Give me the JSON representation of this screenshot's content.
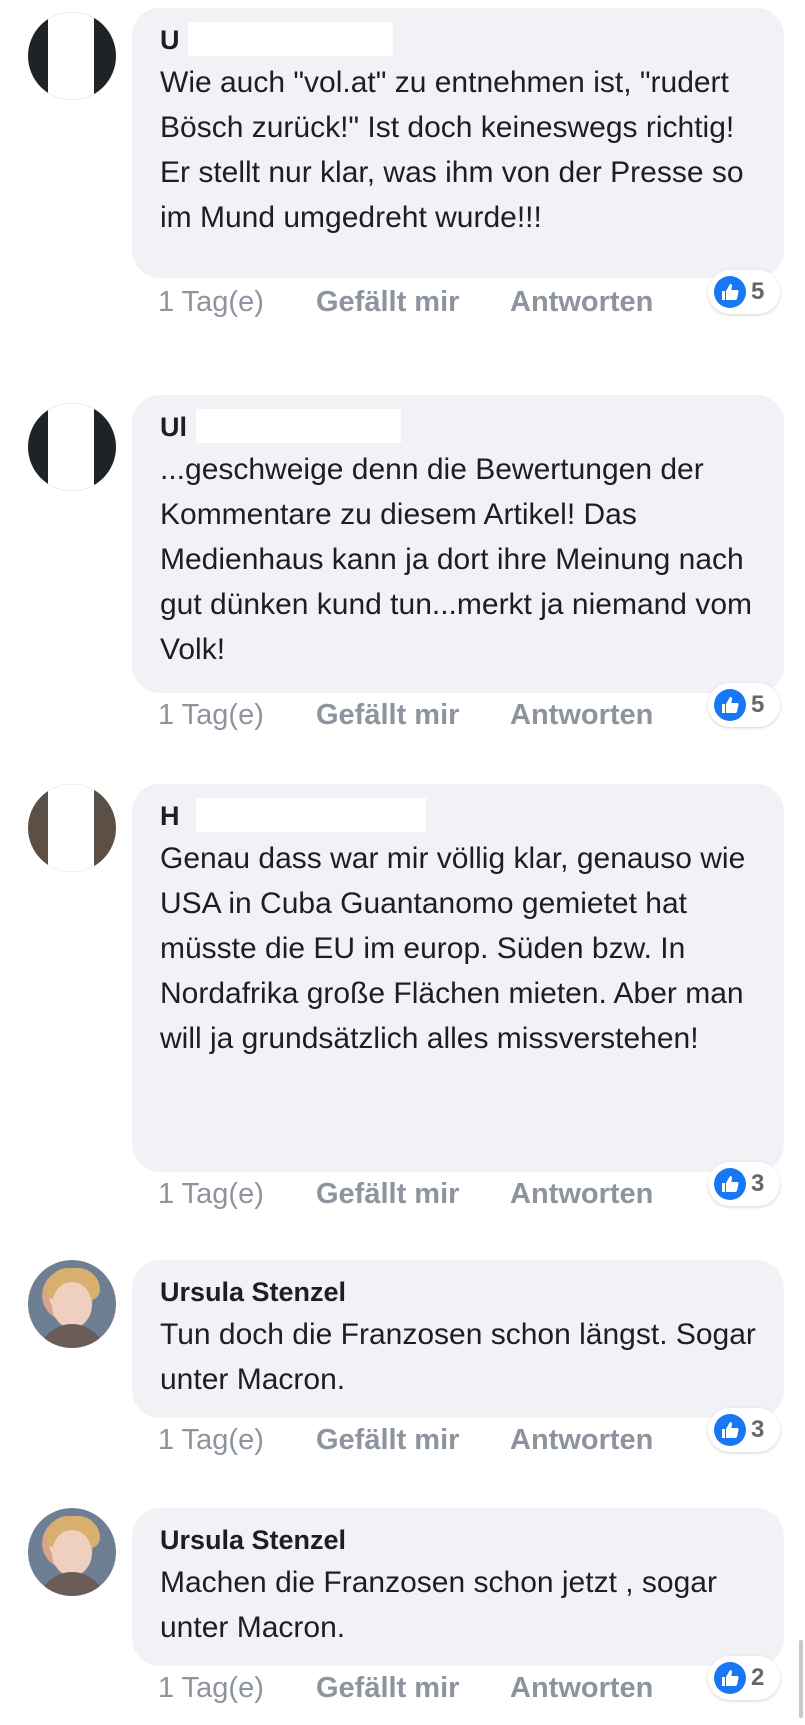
{
  "comments": [
    {
      "author": "U",
      "text": "Wie auch \"vol.at\" zu entnehmen ist, \"rudert Bösch zurück!\" Ist doch keineswegs richtig! Er stellt nur klar, was ihm von der Presse so im Mund umgedreht wurde!!!",
      "time": "1 Tag(e)",
      "like_label": "Gefällt mir",
      "reply_label": "Antworten",
      "reactions": "5",
      "reaction_icon": "like-icon"
    },
    {
      "author": "Ul",
      "text": "...geschweige denn die Bewertungen der Kommentare zu diesem Artikel! Das Medienhaus kann ja dort ihre Meinung nach gut dünken kund tun...merkt ja niemand vom Volk!",
      "time": "1 Tag(e)",
      "like_label": "Gefällt mir",
      "reply_label": "Antworten",
      "reactions": "5",
      "reaction_icon": "like-icon"
    },
    {
      "author": "H",
      "text": "Genau dass war mir völlig klar, genauso wie USA in Cuba Guantanomo gemietet hat müsste die EU im europ. Süden bzw. In Nordafrika große Flächen mieten. Aber man will ja grundsätzlich alles missverstehen!",
      "time": "1 Tag(e)",
      "like_label": "Gefällt mir",
      "reply_label": "Antworten",
      "reactions": "3",
      "reaction_icon": "like-icon"
    },
    {
      "author": "Ursula Stenzel",
      "text": "Tun doch die Franzosen schon längst. Sogar unter Macron.",
      "time": "1 Tag(e)",
      "like_label": "Gefällt mir",
      "reply_label": "Antworten",
      "reactions": "3",
      "reaction_icon": "like-icon"
    },
    {
      "author": "Ursula Stenzel",
      "text": "Machen die Franzosen schon jetzt , sogar unter Macron.",
      "time": "1 Tag(e)",
      "like_label": "Gefällt mir",
      "reply_label": "Antworten",
      "reactions": "2",
      "reaction_icon": "like-icon"
    }
  ],
  "colors": {
    "bubble": "#f1f2f6",
    "text": "#1c1e21",
    "meta": "#8d949e",
    "like_blue": "#1877f2"
  }
}
